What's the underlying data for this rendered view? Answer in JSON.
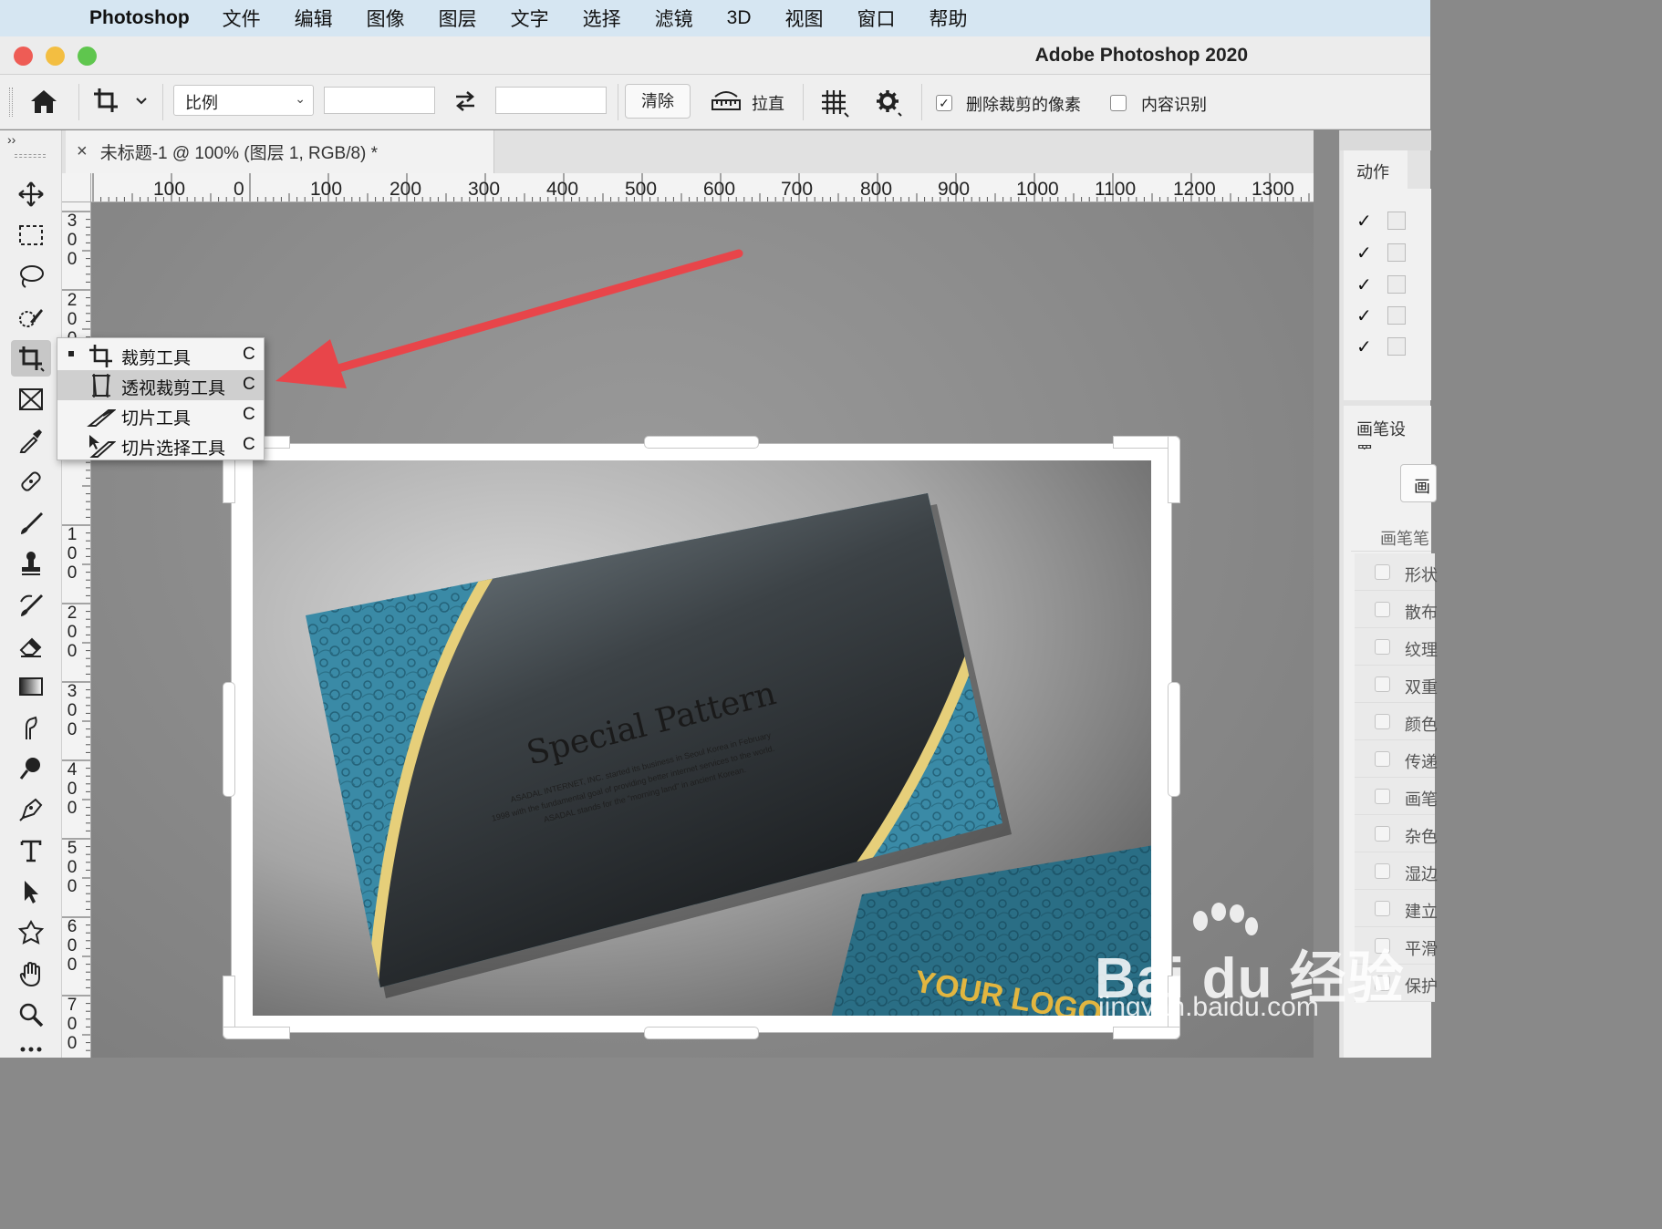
{
  "menubar": {
    "app": "Photoshop",
    "items": [
      "文件",
      "编辑",
      "图像",
      "图层",
      "文字",
      "选择",
      "滤镜",
      "3D",
      "视图",
      "窗口",
      "帮助"
    ]
  },
  "window": {
    "title": "Adobe Photoshop 2020"
  },
  "options": {
    "ratio_select": "比例",
    "clear_button": "清除",
    "straighten_label": "拉直",
    "delete_cropped_label": "删除裁剪的像素",
    "delete_cropped_checked": true,
    "content_aware_label": "内容识别",
    "content_aware_checked": false
  },
  "document": {
    "tab_title": "未标题-1 @ 100% (图层 1, RGB/8) *",
    "close_glyph": "×"
  },
  "rulers": {
    "horizontal": [
      "100",
      "0",
      "100",
      "200",
      "300",
      "400",
      "500",
      "600",
      "700",
      "800",
      "900",
      "1000",
      "1100",
      "1200",
      "1300"
    ],
    "vertical": [
      "300",
      "200",
      "100",
      "200",
      "300",
      "400",
      "500",
      "600",
      "700"
    ]
  },
  "flyout": {
    "items": [
      {
        "label": "裁剪工具",
        "key": "C",
        "icon": "crop-icon",
        "current": true
      },
      {
        "label": "透视裁剪工具",
        "key": "C",
        "icon": "perspective-crop-icon",
        "highlighted": true
      },
      {
        "label": "切片工具",
        "key": "C",
        "icon": "slice-icon"
      },
      {
        "label": "切片选择工具",
        "key": "C",
        "icon": "slice-select-icon"
      }
    ]
  },
  "panels": {
    "actions_tab": "动作",
    "brush_settings_tab": "画笔设置",
    "brush_button": "画",
    "brush_header": "画笔笔",
    "brush_options": [
      "形状",
      "散布",
      "纹理",
      "双重",
      "颜色",
      "传递",
      "画笔",
      "杂色",
      "湿边",
      "建立",
      "平滑",
      "保护"
    ]
  },
  "image": {
    "card_title": "Special Pattern",
    "card_text": [
      "ASADAL INTERNET, INC. started its business in Seoul Korea in February",
      "1998 with the fundamental goal of providing better internet services to the world.",
      "ASADAL stands for the \"morning land\" in ancient Korean."
    ],
    "logo_text": "YOUR LOGO"
  },
  "watermark": {
    "brand": "Bai du 经验",
    "url": "jingyan.baidu.com"
  },
  "colors": {
    "accent_red_arrow": "#e8454a",
    "card_teal": "#3a8aa6",
    "card_gold": "#e6cf7a"
  }
}
